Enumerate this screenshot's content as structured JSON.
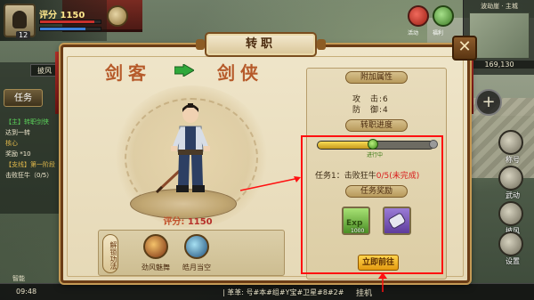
{
  "hud": {
    "level": "12",
    "score": "评分 1150",
    "hp_fraction": 0.9,
    "mp_fraction": 0.75,
    "event_labels": [
      "活动",
      "福利"
    ]
  },
  "minimap": {
    "title": "波劫崖 · 主城",
    "coords": "169,130"
  },
  "left_panel": {
    "tab_label": "披风",
    "quest_tab": "任务",
    "quest_lines": [
      {
        "text": "【主】转职剑侠",
        "style": "main"
      },
      {
        "text": "达到一转",
        "style": "normal"
      },
      {
        "text": "核心",
        "style": "gold"
      },
      {
        "text": "奖励 *10",
        "style": "normal"
      },
      {
        "text": "【支线】第一阶段",
        "style": "gold"
      },
      {
        "text": "击败狂牛（0/5）",
        "style": "normal"
      }
    ]
  },
  "right_hud": {
    "plus": "+",
    "buttons": [
      "称号",
      "武动",
      "披风",
      "设置"
    ]
  },
  "bottom": {
    "time": "09:48",
    "small_label": "智能",
    "chat": "| 革革: 号#本#组#Y宝#卫星#8#2#",
    "hang": "挂机"
  },
  "dialog": {
    "title": "转职",
    "close": "✕",
    "class_from": "剑客",
    "class_to": "剑侠",
    "score_label": "评分:",
    "score_value": "1150",
    "skill_strip_label": "解锁功法",
    "skills": [
      "劲风魅舞",
      "皓月当空"
    ],
    "attr_title": "附加属性",
    "attrs": [
      {
        "name": "攻　击:",
        "value": "6"
      },
      {
        "name": "防　御:",
        "value": "4"
      }
    ],
    "progress_title": "转职进度",
    "progress_fraction": 0.48,
    "progress_status": "进行中",
    "task_prefix": "任务1：击败狂牛",
    "task_progress": "0/5(未完成)",
    "reward_title": "任务奖励",
    "reward_exp_label": "Exp",
    "reward_exp_count": "1000",
    "claim_button": "立即前往"
  },
  "colors": {
    "accent_red": "#d81b1b",
    "class_text": "#b65a2a",
    "frame_brown": "#6b3c16"
  }
}
